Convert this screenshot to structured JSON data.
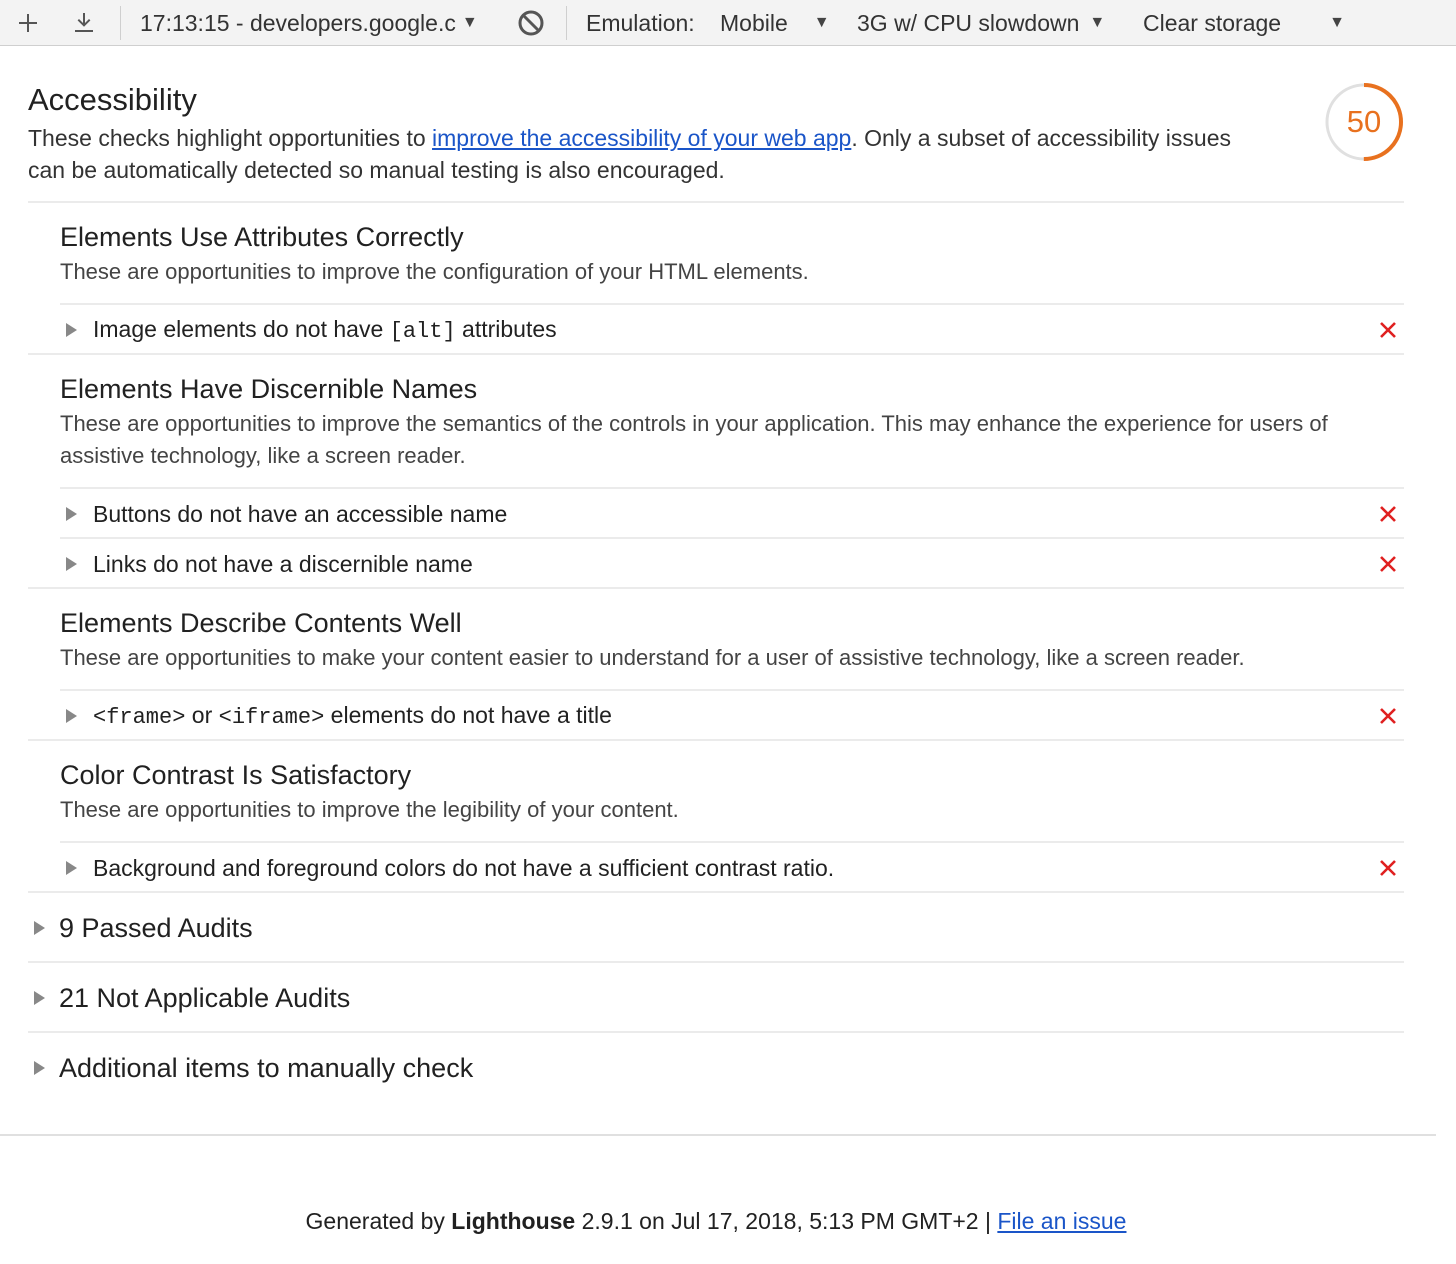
{
  "toolbar": {
    "snapshot": "17:13:15 - developers.google.c",
    "emulation_label": "Emulation:",
    "emulation_value": "Mobile",
    "throttling": "3G w/ CPU slowdown",
    "storage": "Clear storage"
  },
  "category": {
    "title": "Accessibility",
    "desc_before": "These checks highlight opportunities to ",
    "desc_link": "improve the accessibility of your web app",
    "desc_after": ". Only a subset of accessibility issues can be automatically detected so manual testing is also encouraged.",
    "score": "50",
    "score_fraction": 0.5,
    "score_color": "#e8711f"
  },
  "groups": [
    {
      "title": "Elements Use Attributes Correctly",
      "desc": "These are opportunities to improve the configuration of your HTML elements."
    },
    {
      "title": "Elements Have Discernible Names",
      "desc": "These are opportunities to improve the semantics of the controls in your application. This may enhance the experience for users of assistive technology, like a screen reader."
    },
    {
      "title": "Elements Describe Contents Well",
      "desc": "These are opportunities to make your content easier to understand for a user of assistive technology, like a screen reader."
    },
    {
      "title": "Color Contrast Is Satisfactory",
      "desc": "These are opportunities to improve the legibility of your content."
    }
  ],
  "audits": {
    "img_alt": {
      "pre": "Image elements do not have ",
      "code": "[alt]",
      "post": " attributes"
    },
    "button_name": "Buttons do not have an accessible name",
    "link_name": "Links do not have a discernible name",
    "frame_title": {
      "code1": "<frame>",
      "mid": " or ",
      "code2": "<iframe>",
      "post": " elements do not have a title"
    },
    "contrast": "Background and foreground colors do not have a sufficient contrast ratio."
  },
  "fail_color": "#e02020",
  "collapsed": {
    "passed": "9 Passed Audits",
    "not_applicable": "21 Not Applicable Audits",
    "manual": "Additional items to manually check"
  },
  "footer": {
    "generated_by": "Generated by ",
    "product": "Lighthouse",
    "rest": " 2.9.1 on Jul 17, 2018, 5:13 PM GMT+2 | ",
    "link": "File an issue"
  }
}
